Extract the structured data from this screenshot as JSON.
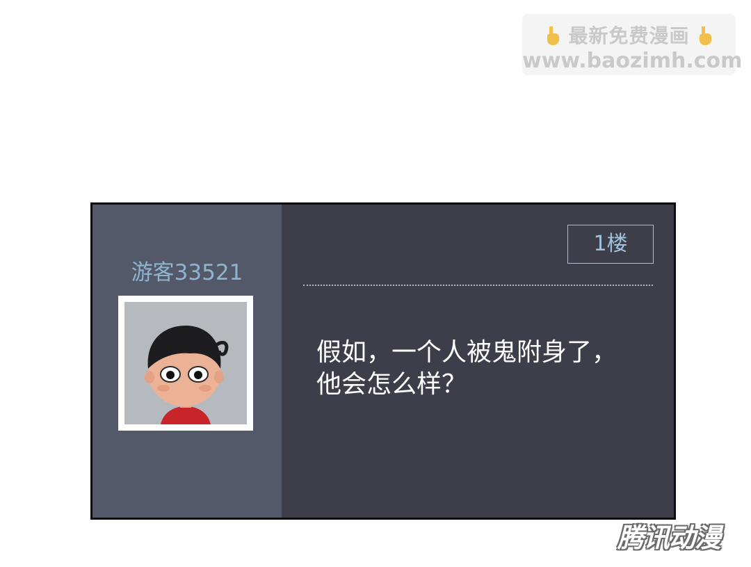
{
  "watermark": {
    "line1": "最新免费漫画",
    "line2": "www.baozimh.com",
    "hand_icon": "pointing-down-hand-icon"
  },
  "comment": {
    "username": "游客33521",
    "floor": "1楼",
    "text_line1": "假如，一个人被鬼附身了，",
    "text_line2": "他会怎么样？"
  },
  "logo": {
    "text": "腾讯动漫"
  },
  "colors": {
    "left_panel": "#545969",
    "right_panel": "#3e3e4a",
    "username": "#8fb4cf",
    "floor_text": "#9fc3dc",
    "comment_text": "#ffffff"
  }
}
